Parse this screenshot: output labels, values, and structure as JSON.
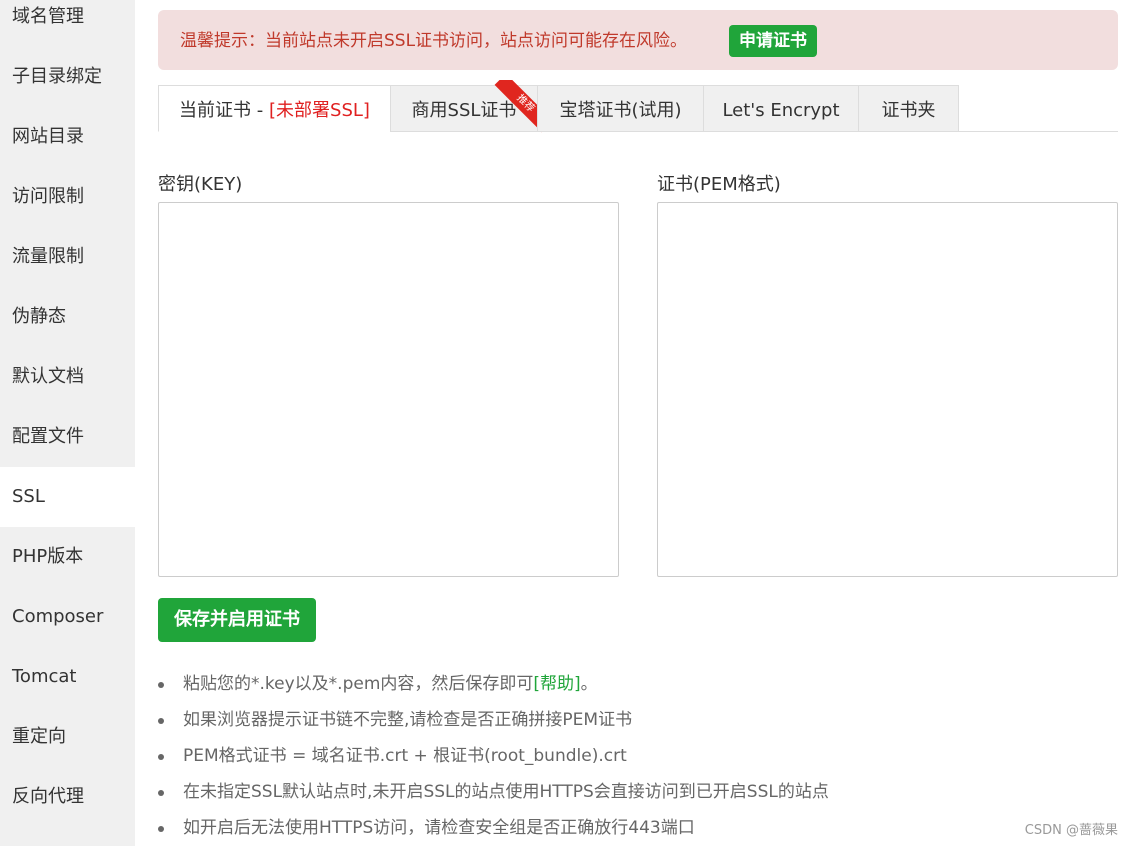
{
  "sidebar": {
    "items": [
      {
        "label": "域名管理"
      },
      {
        "label": "子目录绑定"
      },
      {
        "label": "网站目录"
      },
      {
        "label": "访问限制"
      },
      {
        "label": "流量限制"
      },
      {
        "label": "伪静态"
      },
      {
        "label": "默认文档"
      },
      {
        "label": "配置文件"
      },
      {
        "label": "SSL",
        "active": true
      },
      {
        "label": "PHP版本"
      },
      {
        "label": "Composer"
      },
      {
        "label": "Tomcat"
      },
      {
        "label": "重定向"
      },
      {
        "label": "反向代理"
      }
    ]
  },
  "alert": {
    "text": "温馨提示：当前站点未开启SSL证书访问，站点访问可能存在风险。",
    "button_label": "申请证书"
  },
  "tabs": [
    {
      "label": "当前证书 - ",
      "status": "[未部署SSL]",
      "active": true
    },
    {
      "label": "商用SSL证书",
      "badge": "推荐"
    },
    {
      "label": "宝塔证书(试用)"
    },
    {
      "label": "Let's Encrypt"
    },
    {
      "label": "证书夹"
    }
  ],
  "form": {
    "key_label": "密钥(KEY)",
    "key_value": "",
    "cert_label": "证书(PEM格式)",
    "cert_value": "",
    "save_label": "保存并启用证书"
  },
  "tips": {
    "tip1_text": "粘贴您的*.key以及*.pem内容，然后保存即可",
    "tip1_link": "[帮助]",
    "tip1_suffix": "。",
    "tip2": "如果浏览器提示证书链不完整,请检查是否正确拼接PEM证书",
    "tip3": "PEM格式证书 = 域名证书.crt + 根证书(root_bundle).crt",
    "tip4": "在未指定SSL默认站点时,未开启SSL的站点使用HTTPS会直接访问到已开启SSL的站点",
    "tip5": "如开启后无法使用HTTPS访问，请检查安全组是否正确放行443端口"
  },
  "watermark": "CSDN @蔷薇果",
  "colors": {
    "accent_green": "#20a53a",
    "alert_bg": "#f2dede",
    "alert_text": "#c0392b",
    "sidebar_bg": "#f0f0f0"
  }
}
